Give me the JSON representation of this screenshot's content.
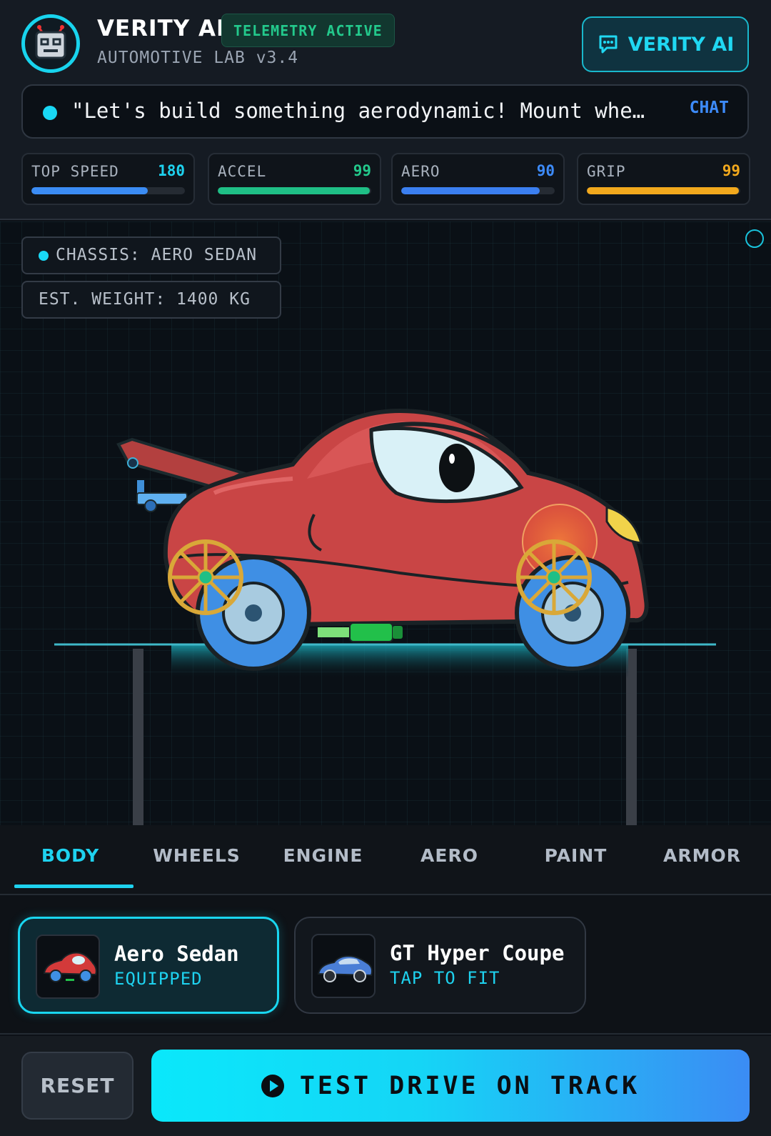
{
  "header": {
    "brand": "VERITY AI",
    "telemetry_badge": "TELEMETRY ACTIVE",
    "subtitle": "AUTOMOTIVE LAB v3.4",
    "chat_button_label": "VERITY AI",
    "avatar_icon": "robot-face-icon"
  },
  "assistant": {
    "message": "\"Let's build something aerodynamic! Mount whe…",
    "chat_link": "CHAT"
  },
  "stats": [
    {
      "label": "TOP SPEED",
      "value": "180",
      "level": 0.76,
      "color": "#3b8cf4",
      "value_color": "#1ed2ef"
    },
    {
      "label": "ACCEL",
      "value": "99",
      "level": 0.99,
      "color": "#1fbf86",
      "value_color": "#23c98c"
    },
    {
      "label": "AERO",
      "value": "90",
      "level": 0.9,
      "color": "#3b7ff0",
      "value_color": "#3d8bfa"
    },
    {
      "label": "GRIP",
      "value": "99",
      "level": 0.99,
      "color": "#f2a91d",
      "value_color": "#f2a91d"
    }
  ],
  "stage": {
    "chassis": "CHASSIS: AERO SEDAN",
    "weight": "EST. WEIGHT: 1400 KG",
    "car_color": "#c94545"
  },
  "tabs": [
    "BODY",
    "WHEELS",
    "ENGINE",
    "AERO",
    "PAINT",
    "ARMOR"
  ],
  "active_tab": "BODY",
  "parts": [
    {
      "name": "Aero Sedan",
      "state": "EQUIPPED",
      "thumb_color": "#d33a3a"
    },
    {
      "name": "GT Hyper Coupe",
      "state": "TAP TO FIT",
      "thumb_color": "#4a7ed6"
    }
  ],
  "footer": {
    "reset_label": "RESET",
    "drive_label": "TEST DRIVE ON TRACK"
  },
  "colors": {
    "accent": "#19d8f5",
    "background": "#0d1117"
  }
}
